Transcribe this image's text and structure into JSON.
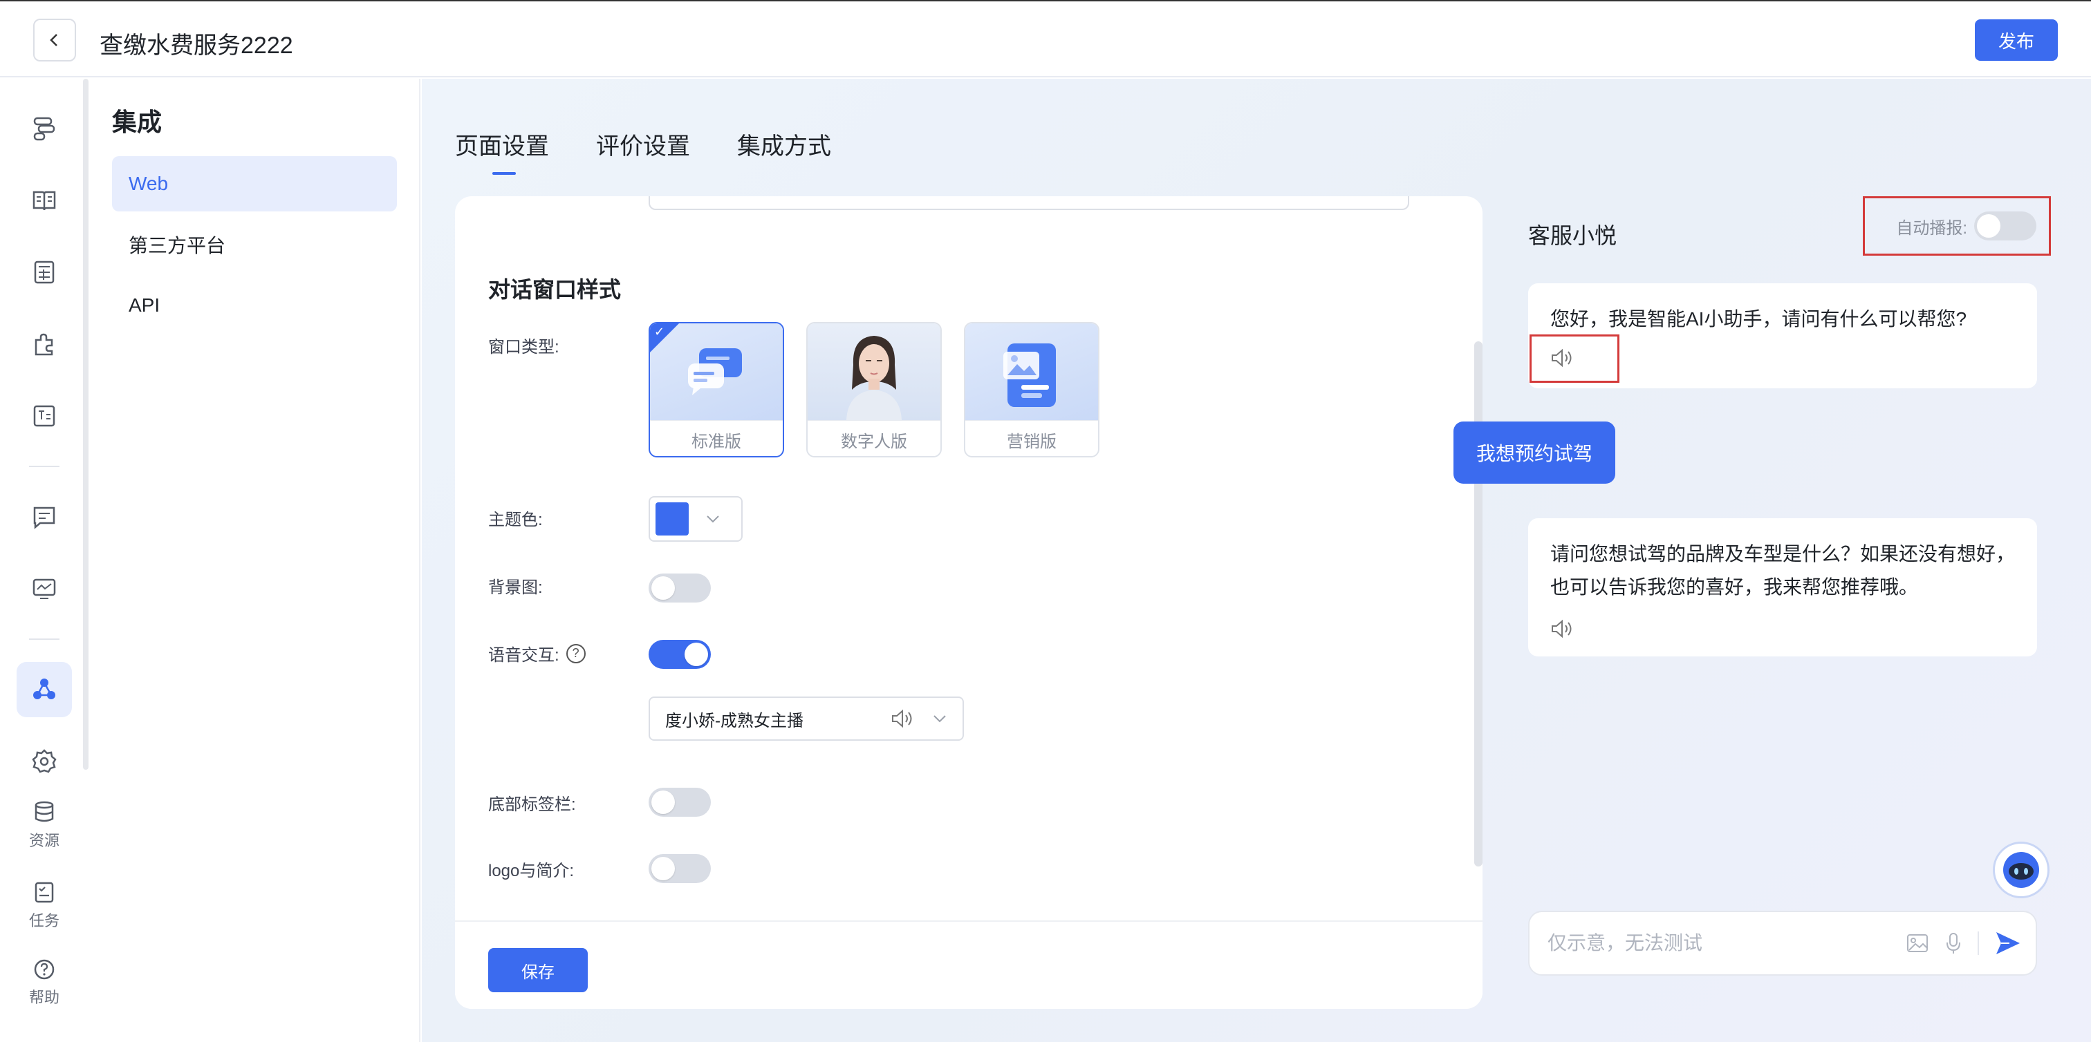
{
  "header": {
    "title": "查缴水费服务2222",
    "publish_label": "发布"
  },
  "rail": {
    "items": [
      {
        "name": "flow-icon"
      },
      {
        "name": "knowledge-icon"
      },
      {
        "name": "table-icon"
      },
      {
        "name": "plugin-icon"
      },
      {
        "name": "text-icon"
      },
      {
        "name": "message-icon"
      },
      {
        "name": "monitor-icon"
      },
      {
        "name": "integration-icon",
        "active": true
      },
      {
        "name": "settings-icon"
      }
    ],
    "resources_label": "资源",
    "tasks_label": "任务",
    "help_label": "帮助"
  },
  "subnav": {
    "title": "集成",
    "items": [
      {
        "label": "Web",
        "active": true
      },
      {
        "label": "第三方平台"
      },
      {
        "label": "API"
      }
    ]
  },
  "tabs": [
    {
      "label": "页面设置",
      "active": true
    },
    {
      "label": "评价设置"
    },
    {
      "label": "集成方式"
    }
  ],
  "settings": {
    "section_title": "对话窗口样式",
    "window_type_label": "窗口类型:",
    "window_types": [
      {
        "label": "标准版",
        "selected": true
      },
      {
        "label": "数字人版"
      },
      {
        "label": "营销版"
      }
    ],
    "theme_color_label": "主题色:",
    "theme_color": "#3b6bef",
    "background_label": "背景图:",
    "background_on": false,
    "voice_label": "语音交互:",
    "voice_on": true,
    "voice_value": "度小娇-成熟女主播",
    "tab_bar_label": "底部标签栏:",
    "tab_bar_on": false,
    "logo_label": "logo与简介:",
    "logo_on": false,
    "save_label": "保存"
  },
  "chat": {
    "agent_name": "客服小悦",
    "autoplay_label": "自动播报:",
    "autoplay_on": false,
    "messages": [
      {
        "role": "bot",
        "text": "您好，我是智能AI小助手，请问有什么可以帮您?"
      },
      {
        "role": "user",
        "text": "我想预约试驾"
      },
      {
        "role": "bot",
        "text": "请问您想试驾的品牌及车型是什么？如果还没有想好，也可以告诉我您的喜好，我来帮您推荐哦。"
      }
    ],
    "input_placeholder": "仅示意，无法测试"
  },
  "colors": {
    "accent": "#3b6bef",
    "highlight": "#d43a3a"
  }
}
